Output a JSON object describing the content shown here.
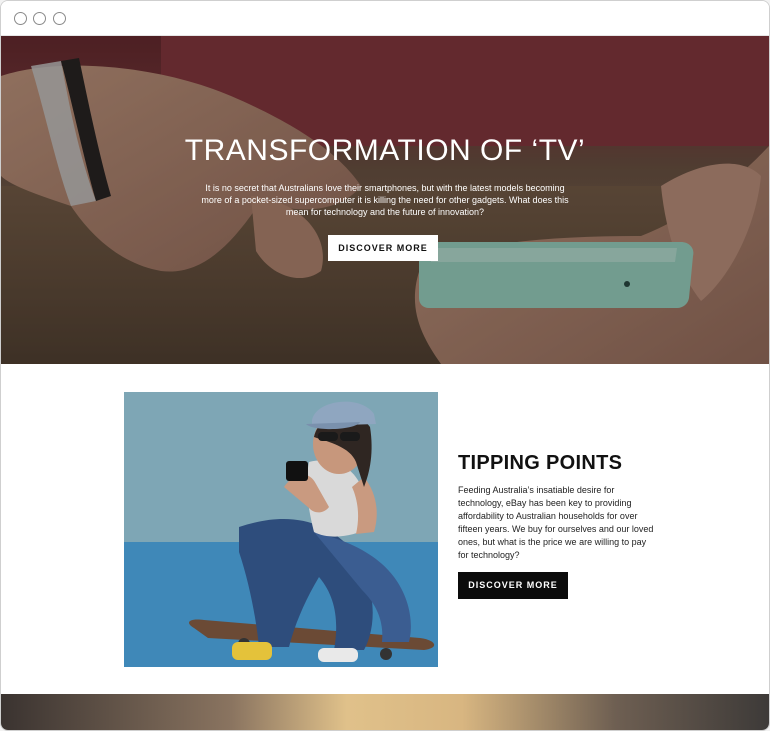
{
  "window": {
    "controls": [
      "close-dot",
      "minimize-dot",
      "maximize-dot"
    ]
  },
  "hero": {
    "title": "TRANSFORMATION OF ‘TV’",
    "description": "It is no secret that Australians love their smartphones, but with the latest models becoming more of a pocket-sized supercomputer it is killing the need for other gadgets. What does this mean for technology and the future of innovation?",
    "button_label": "DISCOVER MORE"
  },
  "feature": {
    "title": "TIPPING POINTS",
    "description": "Feeding Australia’s insatiable desire for technology, eBay has been key to providing affordability to Australian households for over fifteen years. We buy for ourselves and our loved ones, but what is the price we are willing to pay for technology?",
    "button_label": "DISCOVER MORE"
  },
  "colors": {
    "hero_button_bg": "#ffffff",
    "feature_button_bg": "#0b0b0b",
    "text_dark": "#111111"
  }
}
